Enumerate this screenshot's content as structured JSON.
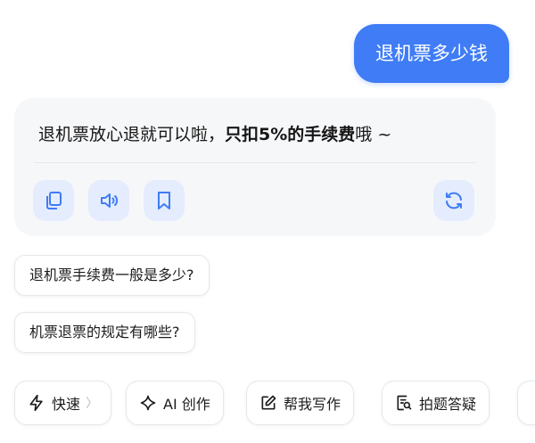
{
  "user_message": "退机票多少钱",
  "reply": {
    "text_before": "退机票放心退就可以啦，",
    "text_bold": "只扣5%的手续费",
    "text_after": "哦 ~",
    "actions": [
      {
        "name": "copy",
        "icon": "copy-icon"
      },
      {
        "name": "read-aloud",
        "icon": "speaker-icon"
      },
      {
        "name": "bookmark",
        "icon": "bookmark-icon"
      },
      {
        "name": "regenerate",
        "icon": "refresh-icon"
      }
    ]
  },
  "suggestions": [
    "退机票手续费一般是多少?",
    "机票退票的规定有哪些?"
  ],
  "toolbar": {
    "fast": "快速",
    "ai_create": "AI 创作",
    "help_write": "帮我写作",
    "photo_question": "拍题答疑"
  },
  "colors": {
    "accent": "#3f7cf6",
    "action_bg": "#e4ecfd",
    "card_bg": "#f6f7f9"
  }
}
